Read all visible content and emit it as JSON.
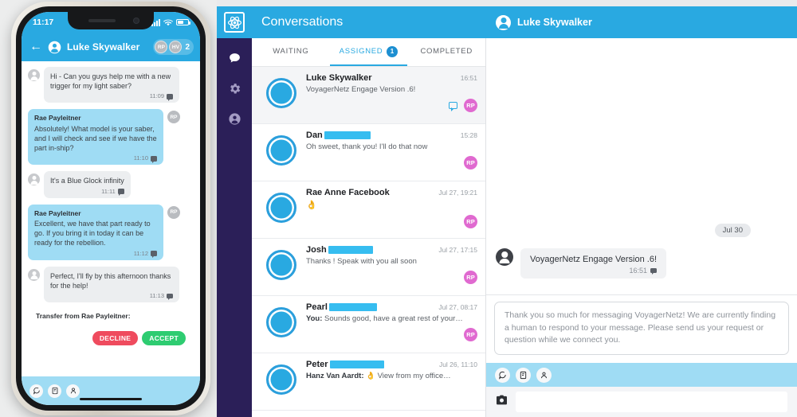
{
  "phone": {
    "status": {
      "time": "11:17",
      "signal_icon": "cellular-bars-icon",
      "wifi_icon": "wifi-icon",
      "battery_icon": "battery-icon"
    },
    "header": {
      "back_icon": "back-arrow-icon",
      "avatar_icon": "person-avatar-icon",
      "title": "Luke Skywalker",
      "participants": [
        {
          "initials": "RP"
        },
        {
          "initials": "HV"
        }
      ],
      "count": "2"
    },
    "messages": [
      {
        "side": "in",
        "sender": "",
        "text": "Hi - Can you guys help me with a new trigger for my light saber?",
        "time": "11:09",
        "status_icon": "message-status-icon"
      },
      {
        "side": "out",
        "sender": "Rae Payleitner",
        "text": "Absolutely! What model is your saber, and I will check and see if we have the part in-ship?",
        "time": "11:10",
        "status_icon": "message-status-icon",
        "avatar_initials": "RP"
      },
      {
        "side": "in",
        "sender": "",
        "text": "It's a Blue Glock infinity",
        "time": "11:11",
        "status_icon": "message-status-icon"
      },
      {
        "side": "out",
        "sender": "Rae Payleitner",
        "text": "Excellent, we have that part ready to go. If you bring it in today it can be ready for the rebellion.",
        "time": "11:12",
        "status_icon": "message-status-icon",
        "avatar_initials": "RP"
      },
      {
        "side": "in",
        "sender": "",
        "text": "Perfect, I'll fly by this afternoon thanks for the help!",
        "time": "11:13",
        "status_icon": "message-status-icon"
      }
    ],
    "transfer": {
      "label": "Transfer from Rae Payleitner:",
      "decline_label": "DECLINE",
      "accept_label": "ACCEPT",
      "decline_color": "#ef4b5e",
      "accept_color": "#2ecc71"
    },
    "toolbar": [
      {
        "icon": "chat-bubble-icon"
      },
      {
        "icon": "note-document-icon"
      },
      {
        "icon": "person-icon"
      }
    ]
  },
  "app": {
    "topbar": {
      "logo_icon": "voyagernetz-atom-logo-icon",
      "title": "Conversations",
      "bg_color": "#29a9e1"
    },
    "rail": [
      {
        "icon": "chat-bubble-icon",
        "active": true
      },
      {
        "icon": "gear-icon",
        "active": false
      },
      {
        "icon": "person-icon",
        "active": false
      }
    ],
    "tabs": [
      {
        "label": "WAITING",
        "badge": "",
        "active": false
      },
      {
        "label": "ASSIGNED",
        "badge": "1",
        "active": true
      },
      {
        "label": "COMPLETED",
        "badge": "",
        "active": false
      }
    ],
    "conversations": [
      {
        "name": "Luke Skywalker",
        "redacted_width": 0,
        "time": "16:51",
        "snippet_prefix": "",
        "snippet": "VoyagerNetz Engage Version .6!",
        "agent": "RP",
        "show_chat_icon": true,
        "selected": true,
        "emoji": ""
      },
      {
        "name": "Dan",
        "redacted_width": 58,
        "time": "15:28",
        "snippet_prefix": "",
        "snippet": "Oh sweet, thank you! I'll do that now",
        "agent": "RP",
        "show_chat_icon": false,
        "selected": false,
        "emoji": ""
      },
      {
        "name": "Rae Anne Facebook",
        "redacted_width": 0,
        "time": "Jul 27, 19:21",
        "snippet_prefix": "",
        "snippet": "",
        "emoji": "👌",
        "agent": "RP",
        "show_chat_icon": false,
        "selected": false
      },
      {
        "name": "Josh",
        "redacted_width": 56,
        "time": "Jul 27, 17:15",
        "snippet_prefix": "",
        "snippet": "Thanks ! Speak with you all soon",
        "agent": "RP",
        "show_chat_icon": false,
        "selected": false,
        "emoji": ""
      },
      {
        "name": "Pearl",
        "redacted_width": 60,
        "time": "Jul 27, 08:17",
        "snippet_prefix": "You:",
        "snippet": "Sounds good, have a great rest of your…",
        "agent": "RP",
        "show_chat_icon": false,
        "selected": false,
        "emoji": ""
      },
      {
        "name": "Peter",
        "redacted_width": 68,
        "time": "Jul 26, 11:10",
        "snippet_prefix": "Hanz Van Aardt:",
        "snippet": "👌 View from my office…",
        "agent": "",
        "show_chat_icon": false,
        "selected": false,
        "emoji": ""
      }
    ],
    "chat": {
      "header": {
        "avatar_icon": "person-avatar-icon",
        "name": "Luke Skywalker"
      },
      "day_divider": "Jul 30",
      "messages": [
        {
          "avatar_icon": "person-avatar-icon",
          "text": "VoyagerNetz Engage Version .6!",
          "time": "16:51",
          "status_icon": "message-status-icon"
        }
      ],
      "composer": {
        "text": "Thank you so much for messaging VoyagerNetz! We are currently finding a human to respond to your message. Please send us your request or question while we connect you."
      },
      "toolbar": [
        {
          "icon": "chat-bubble-icon"
        },
        {
          "icon": "note-document-icon"
        },
        {
          "icon": "person-icon"
        }
      ],
      "input_row": {
        "camera_icon": "camera-icon",
        "value": ""
      }
    }
  }
}
